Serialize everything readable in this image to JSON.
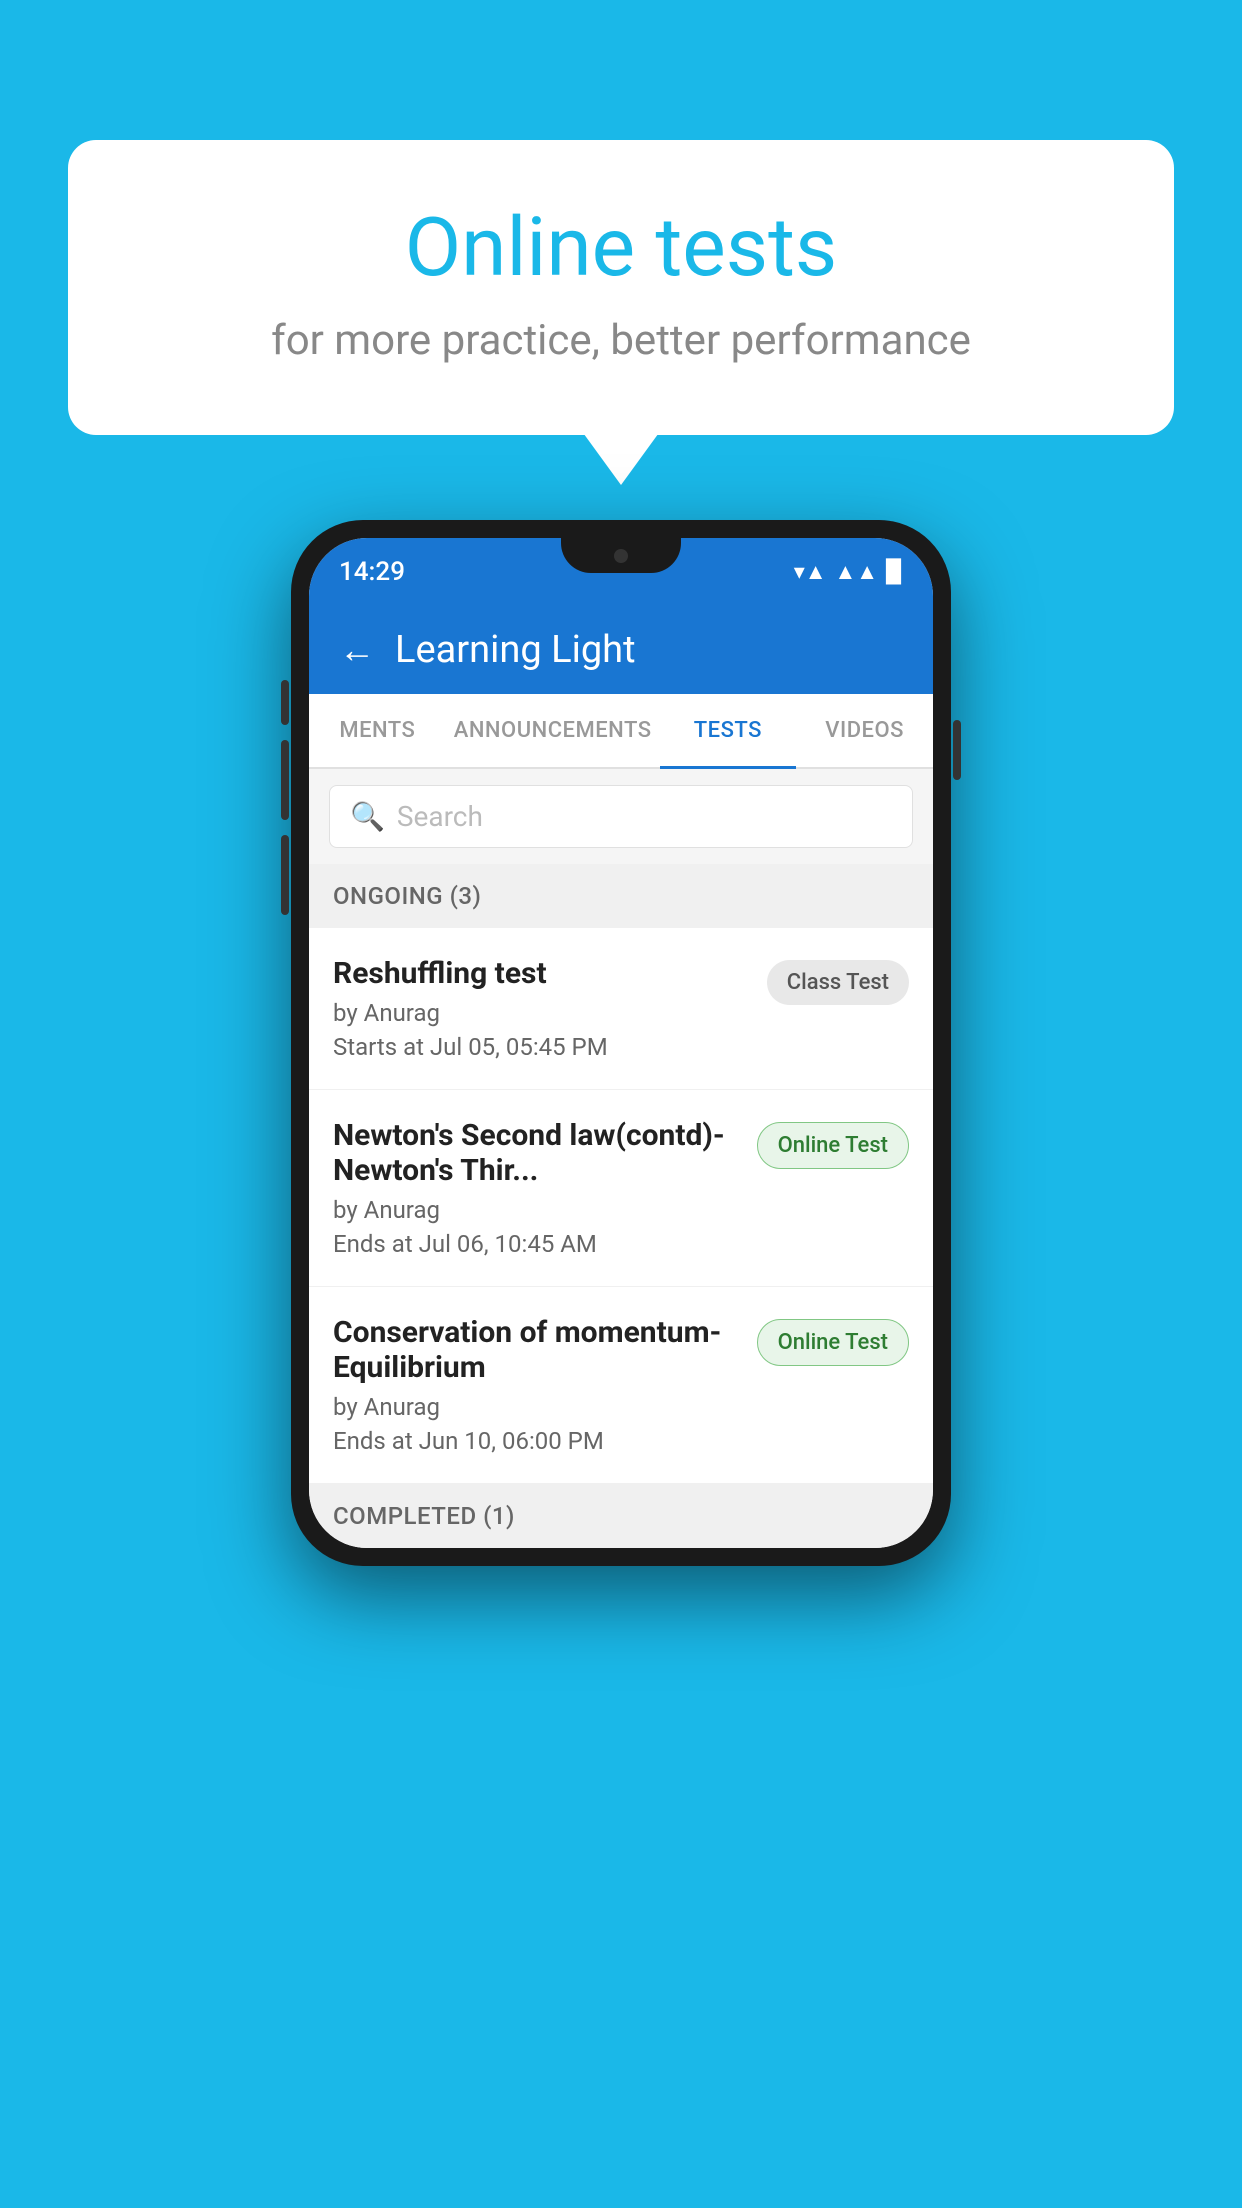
{
  "background_color": "#1ab8e8",
  "speech_bubble": {
    "title": "Online tests",
    "subtitle": "for more practice, better performance"
  },
  "phone": {
    "status_bar": {
      "time": "14:29"
    },
    "header": {
      "title": "Learning Light",
      "back_label": "←"
    },
    "tabs": [
      {
        "label": "MENTS",
        "active": false
      },
      {
        "label": "ANNOUNCEMENTS",
        "active": false
      },
      {
        "label": "TESTS",
        "active": true
      },
      {
        "label": "VIDEOS",
        "active": false
      }
    ],
    "search": {
      "placeholder": "Search"
    },
    "ongoing_section": {
      "label": "ONGOING (3)",
      "tests": [
        {
          "name": "Reshuffling test",
          "author": "by Anurag",
          "time": "Starts at  Jul 05, 05:45 PM",
          "badge": "Class Test",
          "badge_type": "class"
        },
        {
          "name": "Newton's Second law(contd)-Newton's Thir...",
          "author": "by Anurag",
          "time": "Ends at  Jul 06, 10:45 AM",
          "badge": "Online Test",
          "badge_type": "online"
        },
        {
          "name": "Conservation of momentum-Equilibrium",
          "author": "by Anurag",
          "time": "Ends at  Jun 10, 06:00 PM",
          "badge": "Online Test",
          "badge_type": "online"
        }
      ]
    },
    "completed_section": {
      "label": "COMPLETED (1)"
    }
  }
}
